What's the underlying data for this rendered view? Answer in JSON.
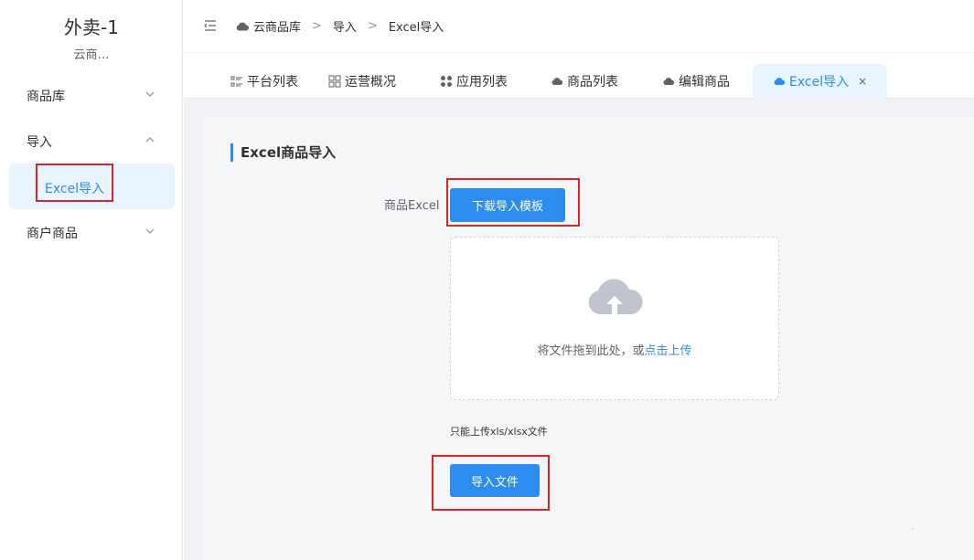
{
  "sidebar": {
    "title": "外卖-1",
    "subtitle": "云商…",
    "menu": [
      {
        "label": "商品库",
        "expanded": false
      },
      {
        "label": "导入",
        "expanded": true,
        "children": [
          {
            "label": "Excel导入",
            "active": true
          }
        ]
      },
      {
        "label": "商户商品",
        "expanded": false
      }
    ]
  },
  "header": {
    "breadcrumb": [
      "云商品库",
      "导入",
      "Excel导入"
    ],
    "separator": ">"
  },
  "tabs": [
    {
      "label": "平台列表",
      "icon": "list-icon"
    },
    {
      "label": "运营概况",
      "icon": "grid-icon"
    },
    {
      "label": "应用列表",
      "icon": "apps-icon"
    },
    {
      "label": "商品列表",
      "icon": "cloud-icon"
    },
    {
      "label": "编辑商品",
      "icon": "cloud-icon"
    },
    {
      "label": "Excel导入",
      "icon": "cloud-icon",
      "active": true,
      "close": "×"
    }
  ],
  "main": {
    "section_title": "Excel商品导入",
    "form_label": "商品Excel",
    "download_button": "下载导入模板",
    "upload": {
      "text_prefix": "将文件拖到此处，或",
      "text_link": "点击上传",
      "icon": "cloud-upload-icon"
    },
    "tip": "只能上传xls/xlsx文件",
    "import_button": "导入文件"
  },
  "colors": {
    "accent": "#2d8cf0",
    "highlight_border": "#e02424",
    "active_bg": "#e8f4ff"
  }
}
